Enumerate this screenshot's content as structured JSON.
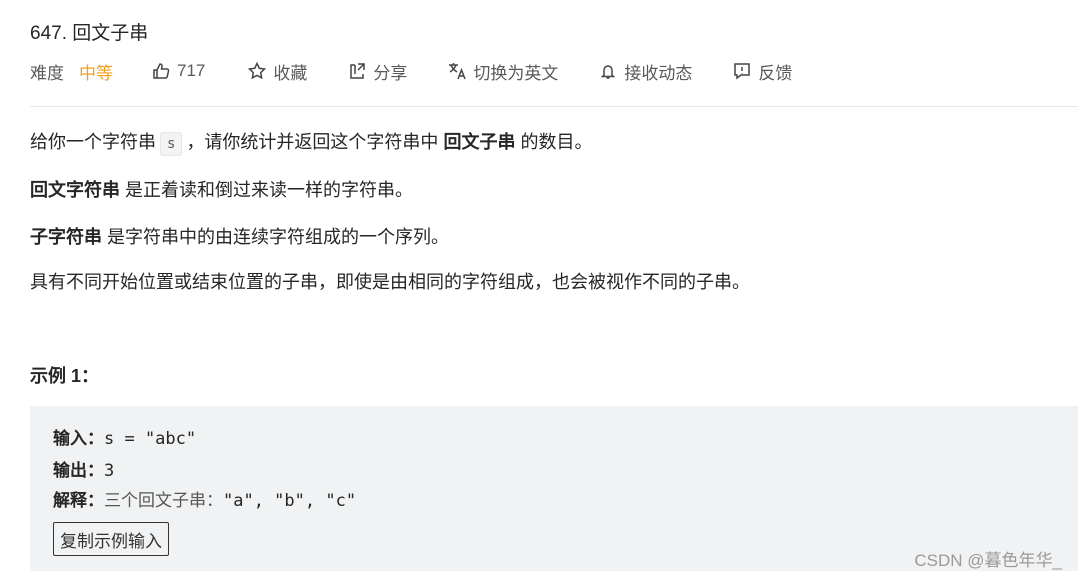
{
  "problem": {
    "title": "647. 回文子串"
  },
  "meta": {
    "difficulty_label": "难度",
    "difficulty_value": "中等",
    "likes": "717",
    "favorite_label": "收藏",
    "share_label": "分享",
    "translate_label": "切换为英文",
    "notify_label": "接收动态",
    "feedback_label": "反馈",
    "colors": {
      "difficulty_medium": "#f0a020"
    }
  },
  "description": {
    "p1_prefix": "给你一个字符串",
    "p1_code": "s",
    "p1_middle": "，请你统计并返回这个字符串中",
    "p1_bold": "回文子串",
    "p1_suffix": "的数目。",
    "p2_bold": "回文字符串",
    "p2_text": "是正着读和倒过来读一样的字符串。",
    "p3_bold": "子字符串",
    "p3_text": "是字符串中的由连续字符组成的一个序列。",
    "p4_text": "具有不同开始位置或结束位置的子串，即使是由相同的字符组成，也会被视作不同的子串。"
  },
  "example": {
    "title": "示例 1：",
    "input_label": "输入：",
    "input_value": "s = \"abc\"",
    "output_label": "输出：",
    "output_value": "3",
    "explain_label": "解释：",
    "explain_text": "三个回文子串：",
    "explain_values": "\"a\", \"b\", \"c\"",
    "copy_button": "复制示例输入"
  },
  "watermark": "CSDN @暮色年华_",
  "icons": [
    "thumbs-up-icon",
    "star-icon",
    "share-icon",
    "translate-icon",
    "bell-icon",
    "feedback-icon"
  ]
}
